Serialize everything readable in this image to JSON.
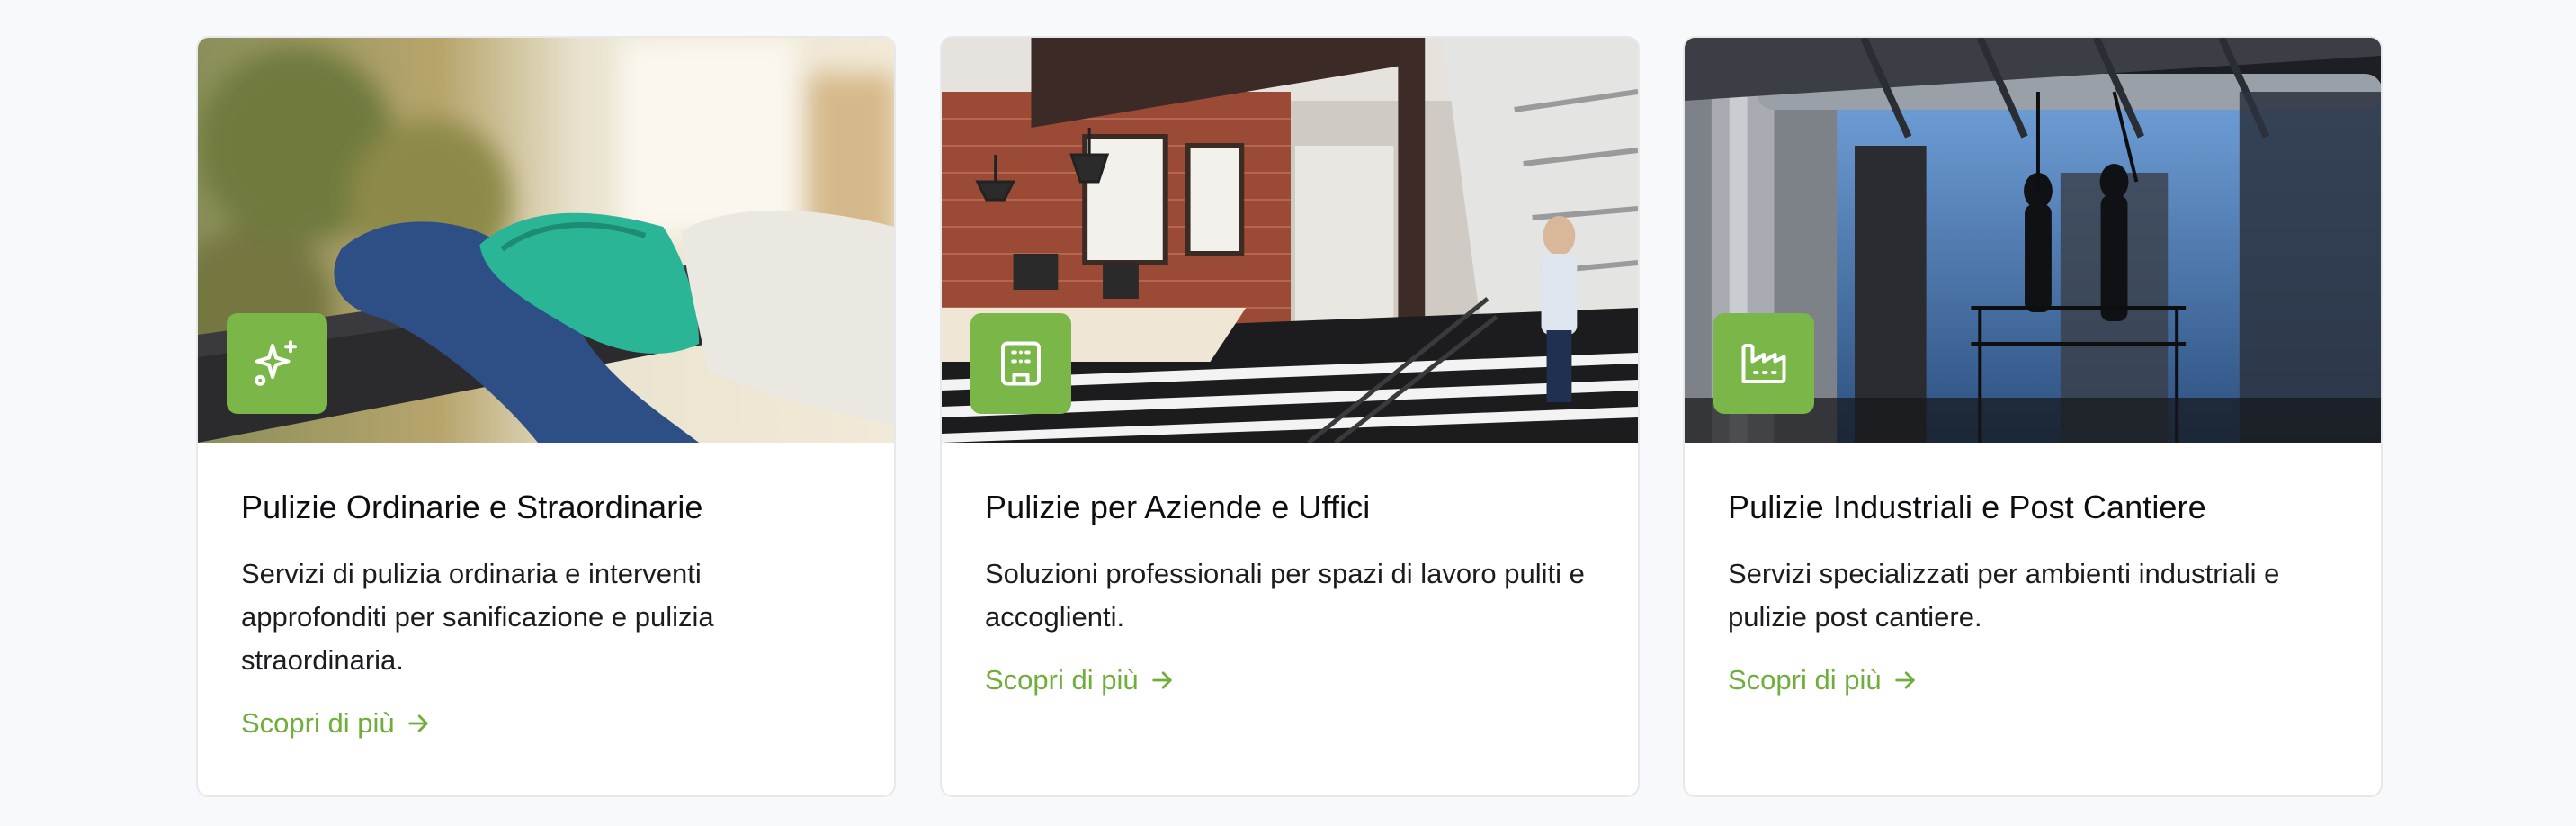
{
  "theme": {
    "accent": "#7ab648",
    "link": "#6fae3b"
  },
  "cards": [
    {
      "icon": "sparkles-icon",
      "title": "Pulizie Ordinarie e Straordinarie",
      "description": "Servizi di pulizia ordinaria e interventi approfonditi per sanificazione e pulizia straordinaria.",
      "link": "Scopri di più"
    },
    {
      "icon": "building-icon",
      "title": "Pulizie per Aziende e Uffici",
      "description": "Soluzioni professionali per spazi di lavoro puliti e accoglienti.",
      "link": "Scopri di più"
    },
    {
      "icon": "factory-icon",
      "title": "Pulizie Industriali e Post Cantiere",
      "description": "Servizi specializzati per ambienti industriali e pulizie post cantiere.",
      "link": "Scopri di più"
    }
  ]
}
